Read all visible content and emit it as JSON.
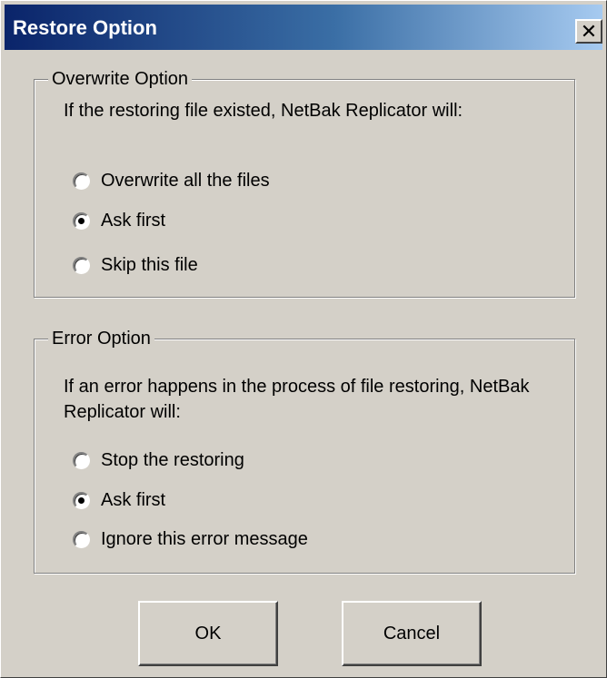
{
  "window": {
    "title": "Restore Option",
    "close_glyph": "✕",
    "close_icon": "close-icon"
  },
  "overwrite_option": {
    "legend": "Overwrite Option",
    "prompt": "If the restoring file existed, NetBak Replicator will:",
    "options": [
      {
        "label": "Overwrite all the files",
        "checked": false
      },
      {
        "label": "Ask first",
        "checked": true
      },
      {
        "label": "Skip this file",
        "checked": false
      }
    ]
  },
  "error_option": {
    "legend": "Error Option",
    "prompt": "If an error happens in the process of file restoring, NetBak Replicator will:",
    "options": [
      {
        "label": "Stop the restoring",
        "checked": false
      },
      {
        "label": "Ask first",
        "checked": true
      },
      {
        "label": "Ignore this error message",
        "checked": false
      }
    ]
  },
  "buttons": {
    "ok_label": "OK",
    "cancel_label": "Cancel"
  }
}
